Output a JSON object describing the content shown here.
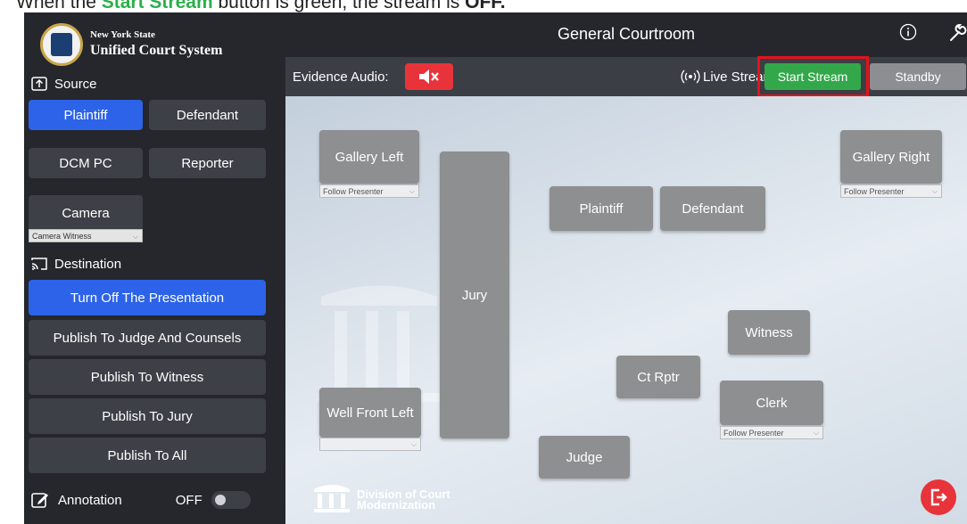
{
  "caption": {
    "pre": "When the ",
    "highlight": "Start Stream",
    "post": " button is green, the stream is ",
    "state": "OFF."
  },
  "logo": {
    "line1": "New York State",
    "line2": "Unified Court System"
  },
  "source": {
    "heading": "Source",
    "buttons": {
      "plaintiff": "Plaintiff",
      "defendant": "Defendant",
      "dcm_pc": "DCM PC",
      "reporter": "Reporter",
      "camera": "Camera"
    },
    "camera_select": "Camera Witness"
  },
  "destination": {
    "heading": "Destination",
    "buttons": [
      "Turn Off The Presentation",
      "Publish To Judge And Counsels",
      "Publish To Witness",
      "Publish To Jury",
      "Publish To All"
    ]
  },
  "annotation": {
    "label": "Annotation",
    "state": "OFF"
  },
  "header": {
    "title": "General Courtroom"
  },
  "toolbar": {
    "evidence_audio_label": "Evidence Audio:",
    "live_stream_label": "Live Stream:",
    "start_stream": "Start Stream",
    "standby": "Standby"
  },
  "stage": {
    "gallery_left": "Gallery Left",
    "gallery_right": "Gallery Right",
    "jury": "Jury",
    "plaintiff": "Plaintiff",
    "defendant": "Defendant",
    "witness": "Witness",
    "ct_rptr": "Ct Rptr",
    "clerk": "Clerk",
    "well_front_left": "Well Front Left",
    "judge": "Judge",
    "follow_presenter": "Follow Presenter"
  },
  "dcm": {
    "line1": "Division of Court",
    "line2": "Modernization"
  },
  "colors": {
    "active_blue": "#2c63e8",
    "stream_green": "#33a84a",
    "mute_red": "#e8333a",
    "highlight_frame": "#e3131b"
  }
}
